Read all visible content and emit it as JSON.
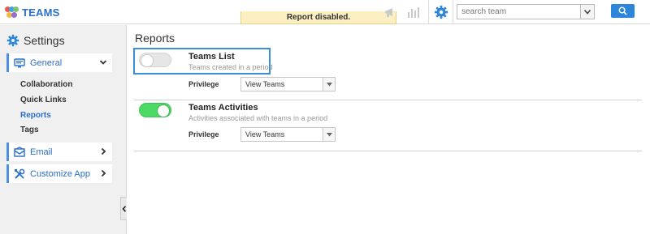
{
  "app": {
    "title": "TEAMS"
  },
  "toast": {
    "text": "Report disabled."
  },
  "search": {
    "placeholder": "search team"
  },
  "sidebar": {
    "heading": "Settings",
    "sections": [
      {
        "label": "General",
        "icon": "monitor-icon",
        "expanded": true
      },
      {
        "label": "Email",
        "icon": "envelope-icon",
        "expanded": false
      },
      {
        "label": "Customize App",
        "icon": "tools-icon",
        "expanded": false
      }
    ],
    "general_items": [
      {
        "label": "Collaboration",
        "active": false
      },
      {
        "label": "Quick Links",
        "active": false
      },
      {
        "label": "Reports",
        "active": true
      },
      {
        "label": "Tags",
        "active": false
      }
    ]
  },
  "main": {
    "title": "Reports",
    "reports": [
      {
        "title": "Teams List",
        "description": "Teams created in a period",
        "enabled": false,
        "privilege_label": "Privilege",
        "privilege_value": "View Teams"
      },
      {
        "title": "Teams Activities",
        "description": "Activities associated with teams in a period",
        "enabled": true,
        "privilege_label": "Privilege",
        "privilege_value": "View Teams"
      }
    ]
  },
  "colors": {
    "accent": "#2a6fc9",
    "toggle_on": "#4cd964",
    "toggle_off": "#e6e6e6",
    "toast_bg": "#fcf0c3",
    "search_button": "#2d86d9"
  }
}
